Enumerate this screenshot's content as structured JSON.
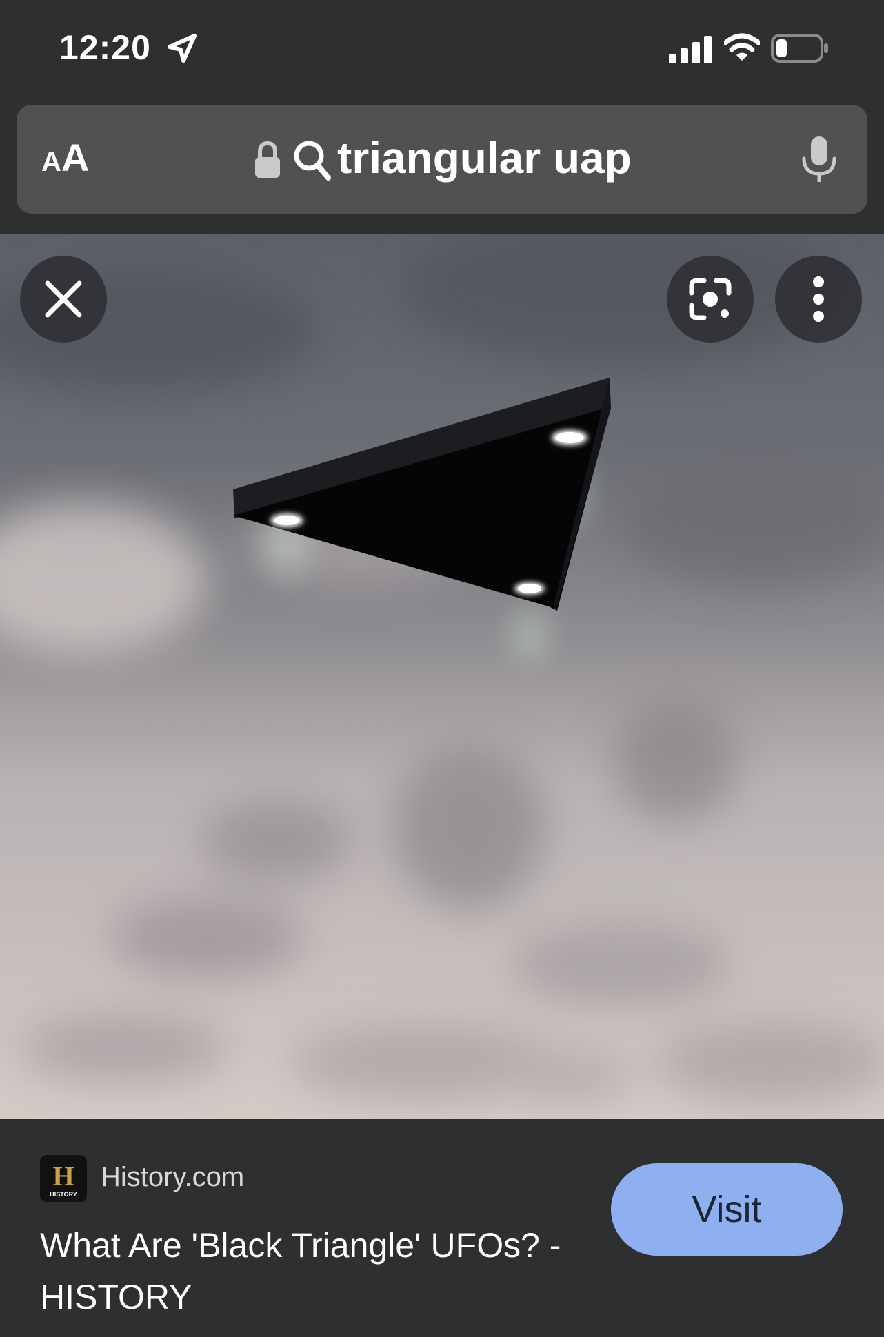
{
  "status_bar": {
    "time": "12:20",
    "icons": [
      "location-arrow-icon",
      "cellular-signal-icon",
      "wifi-icon",
      "battery-icon"
    ]
  },
  "url_bar": {
    "text_size_label_small": "A",
    "text_size_label_large": "A",
    "query": "triangular uap",
    "icons": [
      "lock-icon",
      "search-icon",
      "microphone-icon"
    ]
  },
  "image_viewer": {
    "buttons": [
      "close-icon",
      "lens-icon",
      "more-vertical-icon"
    ]
  },
  "result": {
    "source": "History.com",
    "logo_letter": "H",
    "logo_word": "HISTORY",
    "title": "What Are 'Black Triangle' UFOs? - HISTORY",
    "visit_label": "Visit"
  },
  "colors": {
    "chrome_bg": "#2e2f31",
    "url_bar_bg": "#505153",
    "visit_button": "#8fb0f0",
    "history_gold": "#c9a24b"
  }
}
